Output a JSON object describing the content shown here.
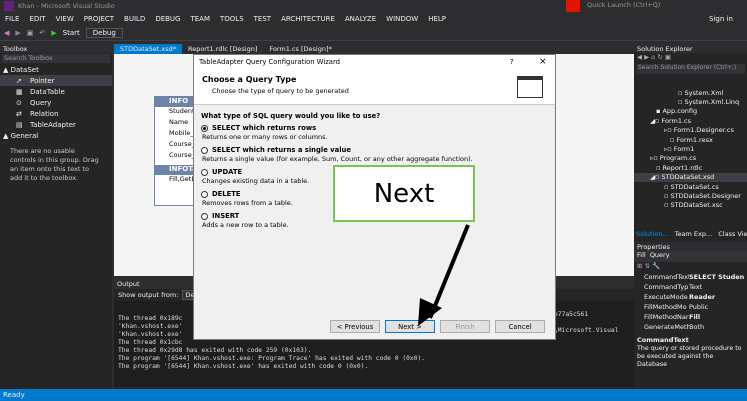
{
  "window": {
    "title": "Khan - Microsoft Visual Studio",
    "quick_launch": "Quick Launch (Ctrl+Q)",
    "sign_in": "Sign in"
  },
  "menu": [
    "FILE",
    "EDIT",
    "VIEW",
    "PROJECT",
    "BUILD",
    "DEBUG",
    "TEAM",
    "TOOLS",
    "TEST",
    "ARCHITECTURE",
    "ANALYZE",
    "WINDOW",
    "HELP"
  ],
  "toolbar": {
    "start": "Start",
    "config": "Debug"
  },
  "toolbox": {
    "title": "Toolbox",
    "search": "Search Toolbox",
    "group": "DataSet",
    "items": [
      "Pointer",
      "DataTable",
      "Query",
      "Relation",
      "TableAdapter"
    ],
    "general": "General",
    "empty_msg": "There are no usable controls in this group. Drag an item onto this text to add it to the toolbox."
  },
  "doc_tabs": [
    "STDDataSet.xsd*",
    "Report1.rdlc [Design]",
    "Form1.cs [Design]*"
  ],
  "designer": {
    "table": "INFO",
    "columns": [
      "Student_",
      "Name",
      "Mobile_I",
      "Course_I",
      "Course_P"
    ],
    "adapter": "INFOTa",
    "fill": "Fill,GetDa"
  },
  "solution": {
    "title": "Solution Explorer",
    "search": "Search Solution Explorer (Ctrl+;)",
    "items": [
      "System.Xml",
      "System.Xml.Linq",
      "App.config",
      "Form1.cs",
      "Form1.Designer.cs",
      "Form1.resx",
      "Form1",
      "Program.cs",
      "Report1.rdlc",
      "STDDataSet.xsd",
      "STDDataSet.cs",
      "STDDataSet.Designer",
      "STDDataSet.xsc"
    ],
    "tabs": [
      "Solution...",
      "Team Exp...",
      "Class View"
    ]
  },
  "properties": {
    "title": "Properties",
    "object": "Fill  Query",
    "rows": [
      [
        "CommandText",
        "SELECT Studen"
      ],
      [
        "CommandTyp",
        "Text"
      ],
      [
        "ExecuteMode",
        "Reader"
      ],
      [
        "FillMethodMo",
        "Public"
      ],
      [
        "FillMethodNar",
        "Fill"
      ],
      [
        "GenerateMeth",
        "Both"
      ]
    ],
    "desc_title": "CommandText",
    "desc": "The query or stored procedure to be executed against the Database"
  },
  "output": {
    "title": "Output",
    "show_from": "Show output from:",
    "source": "Debu",
    "lines": [
      "The thread 0x189c",
      "'Khan.vshost.exe'",
      "'Khan.vshost.exe'",
      "The thread 0x1cbc",
      "The thread 0x29d8 has exited with code 259 (0x103).",
      "The program '[6544] Khan.vshost.exe: Program Trace' has exited with code 0 (0x0).",
      "The program '[6544] Khan.vshost.exe' has exited with code 0 (0x0)."
    ],
    "right_frags": [
      "b77a5c561",
      "\\Microsoft.Visual"
    ]
  },
  "status": "Ready",
  "dialog": {
    "title": "TableAdapter Query Configuration Wizard",
    "help": "?",
    "close": "×",
    "heading": "Choose a Query Type",
    "sub": "Choose the type of query to be generated",
    "question": "What type of SQL query would you like to use?",
    "options": [
      {
        "label": "SELECT which returns rows",
        "desc": "Returns one or many rows or columns."
      },
      {
        "label": "SELECT which returns a single value",
        "desc": "Returns a single value (for example, Sum, Count, or any other aggregate function)."
      },
      {
        "label": "UPDATE",
        "desc": "Changes existing data in a table."
      },
      {
        "label": "DELETE",
        "desc": "Removes rows from a table."
      },
      {
        "label": "INSERT",
        "desc": "Adds a new row to a table."
      }
    ],
    "prev": "< Previous",
    "next": "Next >",
    "finish": "Finish",
    "cancel": "Cancel"
  },
  "annotation": "Next",
  "colors": {
    "accent": "#007acc",
    "callout_border": "#7dc15b",
    "dialog_bg": "#f0f0f0"
  }
}
